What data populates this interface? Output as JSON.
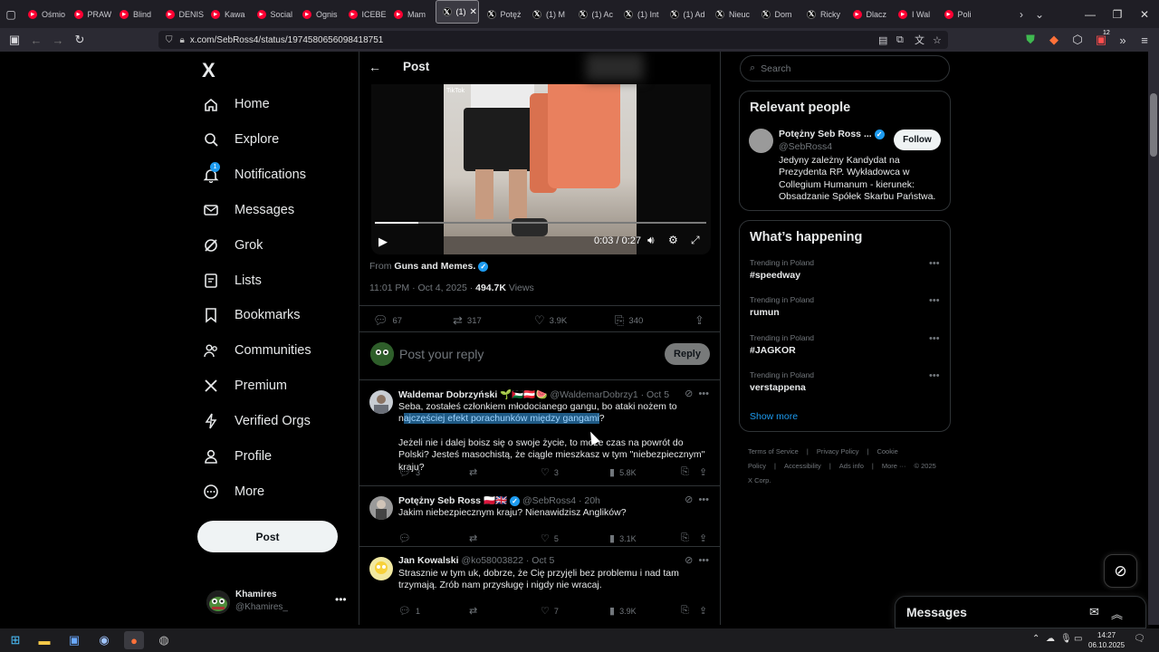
{
  "browser": {
    "tabs": [
      {
        "label": "Ośmio",
        "icon": "youtube-icon",
        "color": "#ff0033"
      },
      {
        "label": "PRAW",
        "icon": "youtube-icon",
        "color": "#ff0033"
      },
      {
        "label": "Blind",
        "icon": "youtube-icon",
        "color": "#ff0033"
      },
      {
        "label": "DENIS",
        "icon": "youtube-icon",
        "color": "#ff0033"
      },
      {
        "label": "Kawa",
        "icon": "youtube-icon",
        "color": "#ff0033"
      },
      {
        "label": "Social",
        "icon": "youtube-icon",
        "color": "#ff0033"
      },
      {
        "label": "Ognis",
        "icon": "youtube-icon",
        "color": "#ff0033"
      },
      {
        "label": "ICEBE",
        "icon": "youtube-icon",
        "color": "#ff0033"
      },
      {
        "label": "Mam",
        "icon": "youtube-icon",
        "color": "#ff0033"
      },
      {
        "label": "(1)",
        "icon": "x-icon",
        "color": "#000000",
        "active": true
      },
      {
        "label": "Potęż",
        "icon": "x-icon",
        "color": "#000000"
      },
      {
        "label": "(1) M",
        "icon": "x-icon",
        "color": "#000000"
      },
      {
        "label": "(1) Ac",
        "icon": "x-icon",
        "color": "#000000"
      },
      {
        "label": "(1) Int",
        "icon": "x-icon",
        "color": "#000000"
      },
      {
        "label": "(1) Ad",
        "icon": "x-icon",
        "color": "#000000"
      },
      {
        "label": "Nieuc",
        "icon": "x-icon",
        "color": "#000000"
      },
      {
        "label": "Dom",
        "icon": "x-icon",
        "color": "#000000"
      },
      {
        "label": "Ricky",
        "icon": "x-icon",
        "color": "#000000"
      },
      {
        "label": "Dlacz",
        "icon": "youtube-icon",
        "color": "#ff0033"
      },
      {
        "label": "I Wal",
        "icon": "youtube-icon",
        "color": "#ff0033"
      },
      {
        "label": "Poli",
        "icon": "youtube-icon",
        "color": "#ff0033"
      }
    ],
    "url": "x.com/SebRoss4/status/1974580656098418751",
    "notification_badge": "12"
  },
  "sidebar": {
    "logo": "X",
    "items": [
      {
        "label": "Home",
        "icon": "home-icon"
      },
      {
        "label": "Explore",
        "icon": "search-icon"
      },
      {
        "label": "Notifications",
        "icon": "bell-icon",
        "badge": "1"
      },
      {
        "label": "Messages",
        "icon": "envelope-icon"
      },
      {
        "label": "Grok",
        "icon": "grok-icon"
      },
      {
        "label": "Lists",
        "icon": "list-icon"
      },
      {
        "label": "Bookmarks",
        "icon": "bookmark-icon"
      },
      {
        "label": "Communities",
        "icon": "people-icon"
      },
      {
        "label": "Premium",
        "icon": "x-logo-icon"
      },
      {
        "label": "Verified Orgs",
        "icon": "lightning-icon"
      },
      {
        "label": "Profile",
        "icon": "person-icon"
      },
      {
        "label": "More",
        "icon": "more-circle-icon"
      }
    ],
    "post_button": "Post",
    "account": {
      "name": "Khamires",
      "handle": "@Khamires_",
      "more": "•••"
    }
  },
  "main": {
    "header_title": "Post",
    "video": {
      "time": "0:03 / 0:27",
      "watermark": "TikTok",
      "progress": 0.13
    },
    "from_label": "From",
    "from_source": "Guns and Memes.",
    "timestamp": "11:01 PM · Oct 4, 2025 · ",
    "views_count": "494.7K",
    "views_label": " Views",
    "stats": {
      "replies": "67",
      "reposts": "317",
      "likes": "3.9K",
      "bookmarks": "340"
    },
    "reply_placeholder": "Post your reply",
    "reply_button": "Reply",
    "replies": [
      {
        "name": "Waldemar Dobrzyński 🌱🇵🇸🇦🇹🍉",
        "handle": "@WaldemarDobrzy1 · Oct 5",
        "body_before": "Seba, zostałeś członkiem młodocianego gangu, bo ataki nożem to n",
        "body_highlight": "ajczęściej efekt porachunków między gangami",
        "body_after": "?",
        "body2": "Jeżeli nie i dalej boisz się o swoje życie, to może czas na powrót do Polski? Jesteś masochistą, że ciągle mieszkasz w tym \"niebezpiecznym\" kraju?",
        "replies": "3",
        "reposts": "",
        "likes": "3",
        "views": "5.8K"
      },
      {
        "name": "Potężny Seb Ross 🇵🇱🇬🇧",
        "handle": "@SebRoss4 · 20h",
        "body": "Jakim niebezpiecznym kraju? Nienawidzisz Anglików?",
        "replies": "",
        "reposts": "",
        "likes": "5",
        "views": "3.1K"
      },
      {
        "name": "Jan Kowalski",
        "handle": "@ko58003822 · Oct 5",
        "body": "Strasznie w tym uk, dobrze, że Cię przyjęli bez problemu i nad tam trzymają. Zrób nam przysługę i nigdy nie wracaj.",
        "replies": "1",
        "reposts": "",
        "likes": "7",
        "views": "3.9K"
      }
    ]
  },
  "right": {
    "search_placeholder": "Search",
    "relevant_title": "Relevant people",
    "person": {
      "name": "Potężny Seb Ross ...",
      "handle": "@SebRoss4",
      "bio": "Jedyny zależny Kandydat na Prezydenta RP. Wykładowca w Collegium Humanum - kierunek: Obsadzanie Spółek Skarbu Państwa.",
      "follow": "Follow"
    },
    "happening_title": "What’s happening",
    "trends": [
      {
        "context": "Trending in Poland",
        "topic": "#speedway"
      },
      {
        "context": "Trending in Poland",
        "topic": "rumun"
      },
      {
        "context": "Trending in Poland",
        "topic": "#JAGKOR"
      },
      {
        "context": "Trending in Poland",
        "topic": "verstappena"
      }
    ],
    "show_more": "Show more",
    "footer": [
      "Terms of Service",
      "|",
      "Privacy Policy",
      "|",
      "Cookie Policy",
      "|",
      "Accessibility",
      "|",
      "Ads info",
      "|",
      "More ···",
      "© 2025 X Corp."
    ]
  },
  "messages_dock": {
    "title": "Messages"
  },
  "taskbar": {
    "time": "14:27",
    "date": "06.10.2025"
  }
}
